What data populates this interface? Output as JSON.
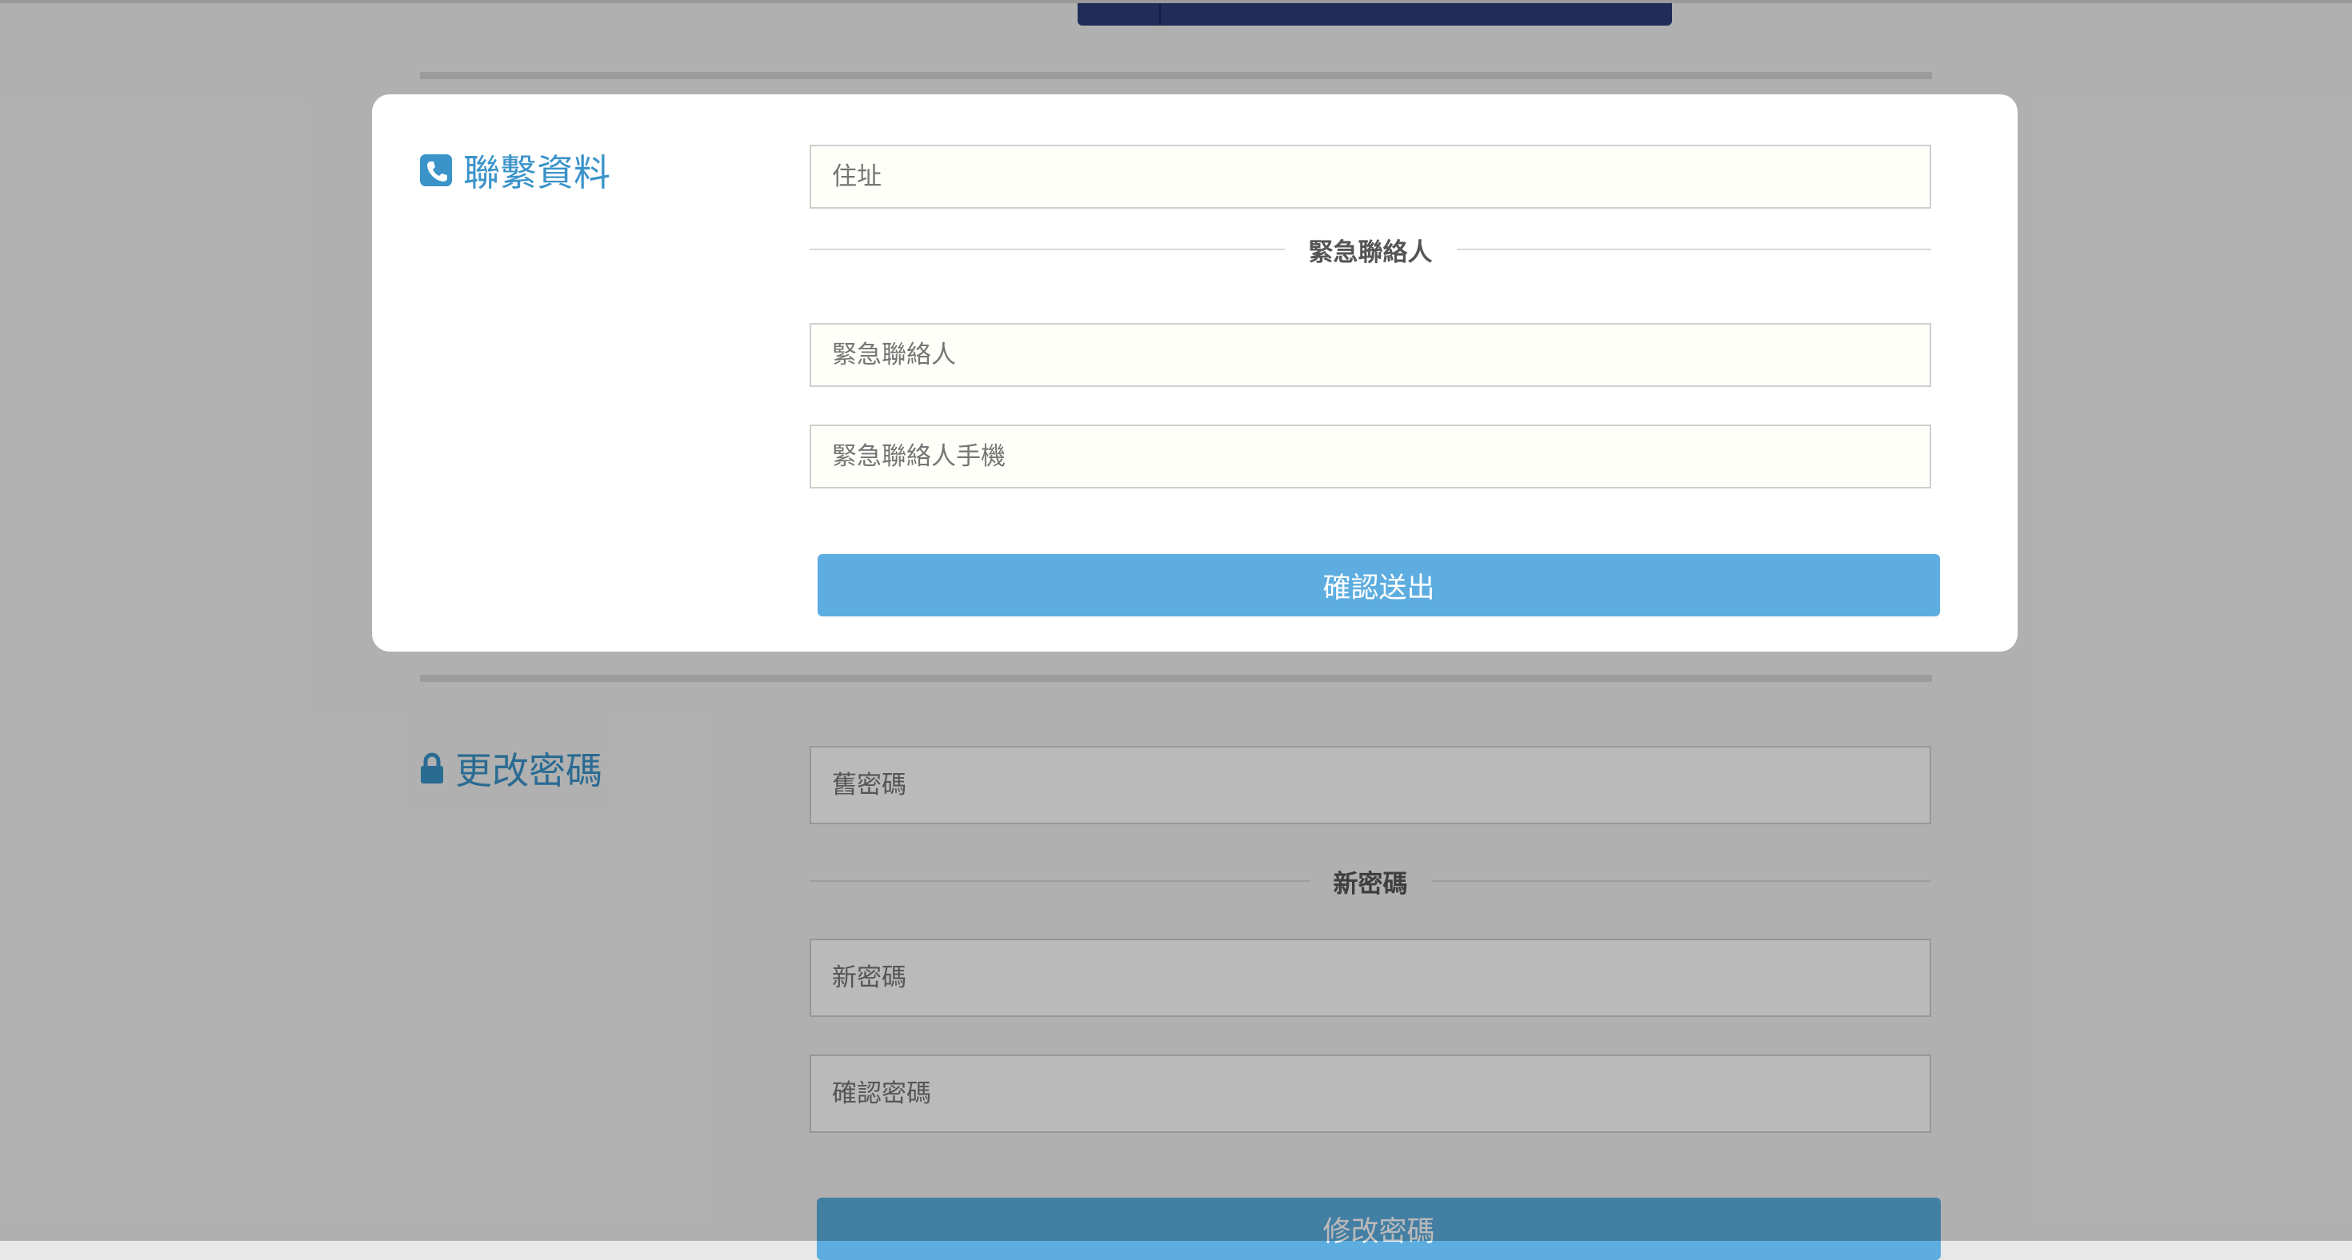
{
  "change_password": {
    "title": "更改密碼",
    "icon": "lock-icon",
    "old_password_placeholder": "舊密碼",
    "new_password_divider": "新密碼",
    "new_password_placeholder": "新密碼",
    "confirm_password_placeholder": "確認密碼",
    "submit_label": "修改密碼"
  },
  "modal": {
    "title": "聯繫資料",
    "icon": "phone-icon",
    "address_placeholder": "住址",
    "emergency_divider": "緊急聯絡人",
    "emergency_contact_placeholder": "緊急聯絡人",
    "emergency_phone_placeholder": "緊急聯絡人手機",
    "submit_label": "確認送出"
  },
  "colors": {
    "accent": "#3a93c9",
    "button": "#5dade0",
    "nav": "#2c3e7a"
  }
}
